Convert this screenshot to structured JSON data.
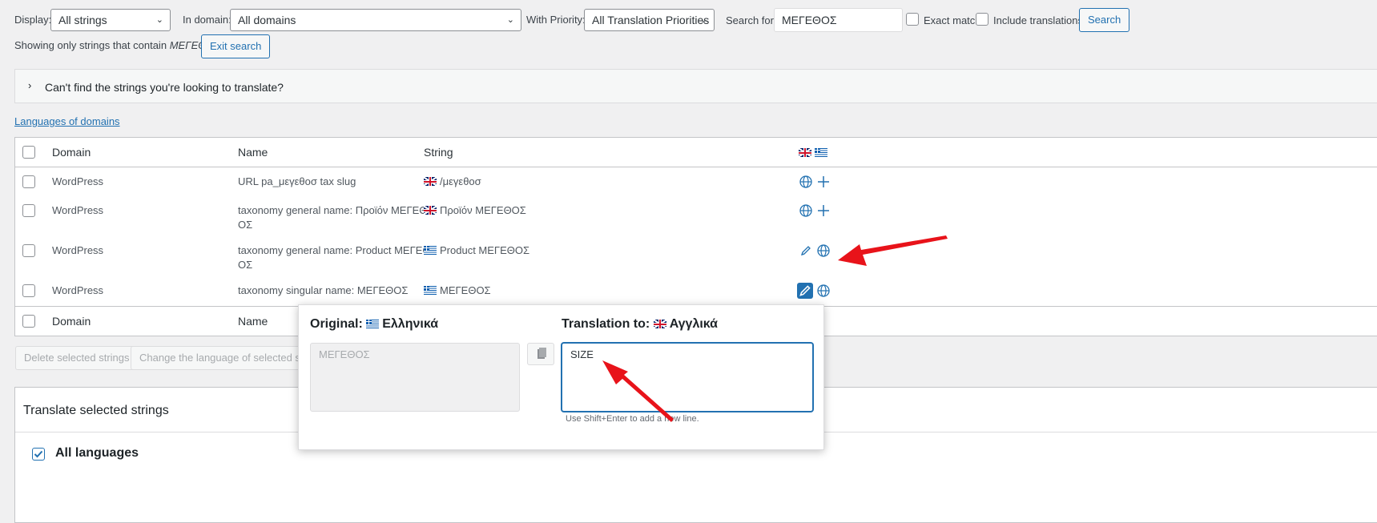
{
  "filters": {
    "display_label": "Display:",
    "display_value": "All strings",
    "domain_label": "In domain:",
    "domain_value": "All domains",
    "priority_label": "With Priority:",
    "priority_value": "All Translation Priorities",
    "search_label": "Search for:",
    "search_value": "ΜΕΓΕΘΟΣ",
    "exact_match_label": "Exact match",
    "include_translations_label": "Include translations",
    "search_button": "Search"
  },
  "search_notice": {
    "text": "Showing only strings that contain",
    "term": "ΜΕΓΕΘΟΣ",
    "exit_button": "Exit search"
  },
  "help_box": {
    "text": "Can't find the strings you're looking to translate?"
  },
  "languages_link": "Languages of domains",
  "table": {
    "headers": {
      "domain": "Domain",
      "name": "Name",
      "string": "String"
    },
    "rows": [
      {
        "domain": "WordPress",
        "name": "URL pa_μεγεθοσ tax slug",
        "flag": "uk",
        "string": "/μεγεθοσ"
      },
      {
        "domain": "WordPress",
        "name_line1": "taxonomy general name: Προϊόν ΜΕΓΕΘ",
        "name_line2": "ΟΣ",
        "flag": "uk",
        "string": "Προϊόν ΜΕΓΕΘΟΣ"
      },
      {
        "domain": "WordPress",
        "name_line1": "taxonomy general name: Product ΜΕΓΕΘ",
        "name_line2": "ΟΣ",
        "flag": "gr",
        "string": "Product ΜΕΓΕΘΟΣ"
      },
      {
        "domain": "WordPress",
        "name": "taxonomy singular name: ΜΕΓΕΘΟΣ",
        "flag": "gr",
        "string": "ΜΕΓΕΘΟΣ"
      }
    ],
    "footer": {
      "domain": "Domain",
      "name": "Name"
    }
  },
  "bulk": {
    "delete_button": "Delete selected strings",
    "change_language_button": "Change the language of selected strings"
  },
  "translate_section": {
    "title": "Translate selected strings",
    "all_languages_label": "All languages"
  },
  "popup": {
    "original_label": "Original:",
    "original_language": "Ελληνικά",
    "original_text": "ΜΕΓΕΘΟΣ",
    "translation_label": "Translation to:",
    "translation_language": "Αγγλικά",
    "translation_text": "SIZE",
    "hint": "Use Shift+Enter to add a new line."
  },
  "colors": {
    "accent": "#2271b1",
    "arrow": "#e8131a"
  }
}
